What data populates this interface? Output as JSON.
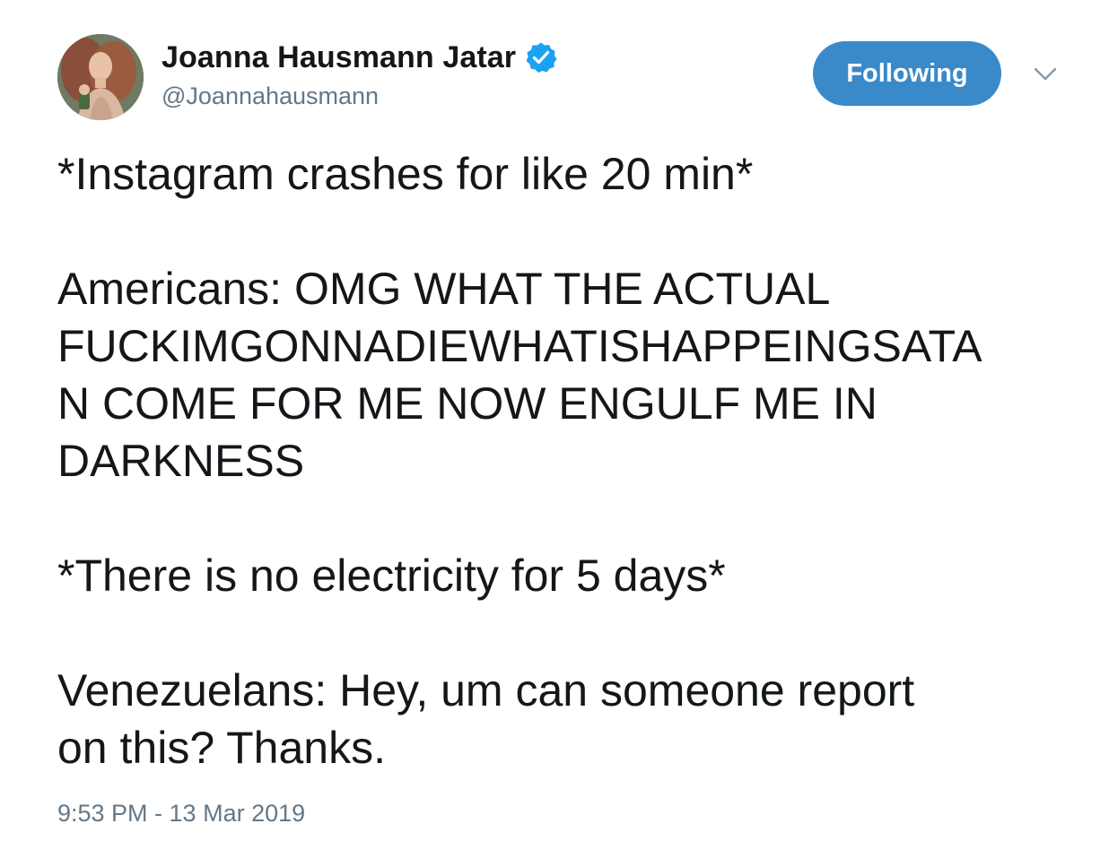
{
  "user": {
    "display_name": "Joanna Hausmann Jatar",
    "handle": "@Joannahausmann",
    "verified": true,
    "avatar_icon": "profile-photo"
  },
  "follow_button": {
    "label": "Following",
    "color": "#3a89c9"
  },
  "menu": {
    "icon": "chevron-down-icon"
  },
  "tweet": {
    "paragraphs": [
      "*Instagram crashes for like 20 min*",
      "Americans: OMG WHAT THE ACTUAL FUCKIMGONNADIEWHATISHAPPEINGSATA\nN COME FOR ME NOW ENGULF ME IN DARKNESS",
      "*There is no electricity for 5 days*",
      "Venezuelans: Hey, um can someone report\non this? Thanks."
    ]
  },
  "timestamp": "9:53 PM - 13 Mar 2019",
  "colors": {
    "text": "#14171a",
    "secondary_text": "#657786",
    "verified_badge": "#1da1f2"
  }
}
